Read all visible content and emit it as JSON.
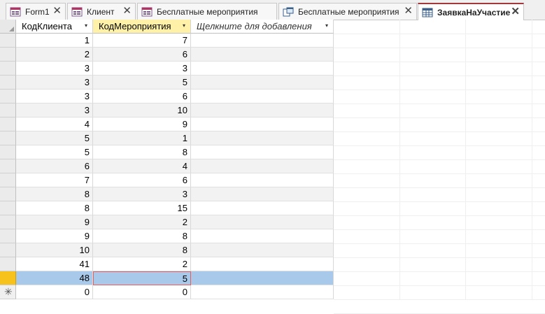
{
  "tabs": [
    {
      "label": "Form1",
      "icon": "form-icon",
      "active": false
    },
    {
      "label": "Клиент",
      "icon": "form-icon",
      "active": false
    },
    {
      "label": "Бесплатные мероприятия",
      "icon": "form-icon",
      "active": false
    },
    {
      "label": "Бесплатные мероприятия",
      "icon": "query-icon",
      "active": false
    },
    {
      "label": "ЗаявкаНаУчастие",
      "icon": "table-icon",
      "active": true
    }
  ],
  "columns": [
    {
      "label": "КодКлиента",
      "sorted": false
    },
    {
      "label": "КодМероприятия",
      "sorted": true
    },
    {
      "label": "Щелкните для добавления"
    }
  ],
  "rows": [
    {
      "client": "1",
      "event": "7"
    },
    {
      "client": "2",
      "event": "6"
    },
    {
      "client": "3",
      "event": "3"
    },
    {
      "client": "3",
      "event": "5"
    },
    {
      "client": "3",
      "event": "6"
    },
    {
      "client": "3",
      "event": "10"
    },
    {
      "client": "4",
      "event": "9"
    },
    {
      "client": "5",
      "event": "1"
    },
    {
      "client": "5",
      "event": "8"
    },
    {
      "client": "6",
      "event": "4"
    },
    {
      "client": "7",
      "event": "6"
    },
    {
      "client": "8",
      "event": "3"
    },
    {
      "client": "8",
      "event": "15"
    },
    {
      "client": "9",
      "event": "2"
    },
    {
      "client": "9",
      "event": "8"
    },
    {
      "client": "10",
      "event": "8"
    },
    {
      "client": "41",
      "event": "2"
    },
    {
      "client": "48",
      "event": "5",
      "current": true
    },
    {
      "client": "0",
      "event": "0",
      "new": true
    }
  ],
  "new_row_marker": "✳",
  "colors": {
    "accent": "#a4373a",
    "selection": "#a9c9ea",
    "current_row_selector": "#f7c21b",
    "sorted_header": "#fff2a8"
  }
}
